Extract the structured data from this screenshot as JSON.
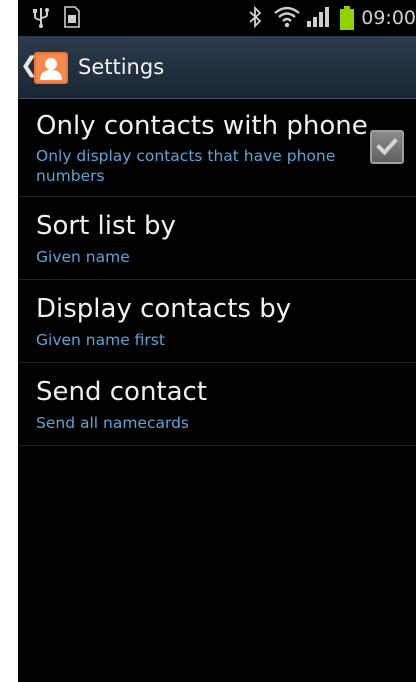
{
  "status_bar": {
    "time": "09:00",
    "icons": [
      "usb-icon",
      "sim-card-icon",
      "bluetooth-icon",
      "wifi-icon",
      "signal-icon",
      "battery-icon"
    ]
  },
  "action_bar": {
    "title": "Settings",
    "back_icon": "chevron-left-icon",
    "app_icon": "contacts-icon"
  },
  "settings": [
    {
      "title": "Only contacts with phone",
      "summary": "Only display contacts that have phone numbers",
      "checked": true
    },
    {
      "title": "Sort list by",
      "summary": "Given name"
    },
    {
      "title": "Display contacts by",
      "summary": "Given name first"
    },
    {
      "title": "Send contact",
      "summary": "Send all namecards"
    }
  ],
  "colors": {
    "background": "#000000",
    "action_bar": "#22313f",
    "summary_text": "#5ba5d8",
    "battery": "#8fd400"
  }
}
